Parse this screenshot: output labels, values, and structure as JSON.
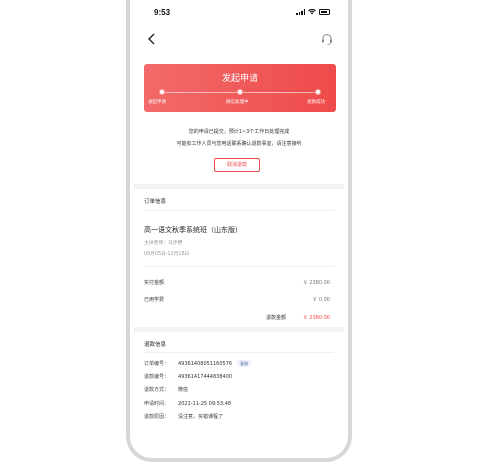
{
  "status_bar": {
    "time": "9:53"
  },
  "banner": {
    "title": "发起申请",
    "steps": [
      "发起申请",
      "微信处理中",
      "退款成功"
    ]
  },
  "notice": {
    "line1": "您的申请已提交，预计1~3个工作日处理完成",
    "line2": "可能有工作人员与您电话联系确认退款事宜，请注意接听"
  },
  "cancel_button": "取消退款",
  "order": {
    "section_title": "订单信息",
    "course_title": "高一语文秋季系统班（山东版）",
    "teacher": "主讲老师：马步野",
    "dates": "09月05日-12月18日",
    "paid_label": "实付金额",
    "paid_value": "￥ 2380.00",
    "used_label": "已用学费",
    "used_value": "￥ 0.00",
    "refund_label": "退款金额",
    "refund_value": "￥ 2380.00"
  },
  "refund_info": {
    "section_title": "退款信息",
    "order_no_label": "订单编号：",
    "order_no": "49361408051160576",
    "copy_label": "复制",
    "refund_no_label": "退款编号：",
    "refund_no": "49361417444838400",
    "method_label": "退款方式：",
    "method": "微信",
    "time_label": "申请时间：",
    "time": "2021-11-25 09:53:48",
    "reason_label": "退款原因：",
    "reason": "没注意，买错课程了"
  },
  "colors": {
    "accent": "#ef4a4a",
    "banner_start": "#f26a6a"
  }
}
